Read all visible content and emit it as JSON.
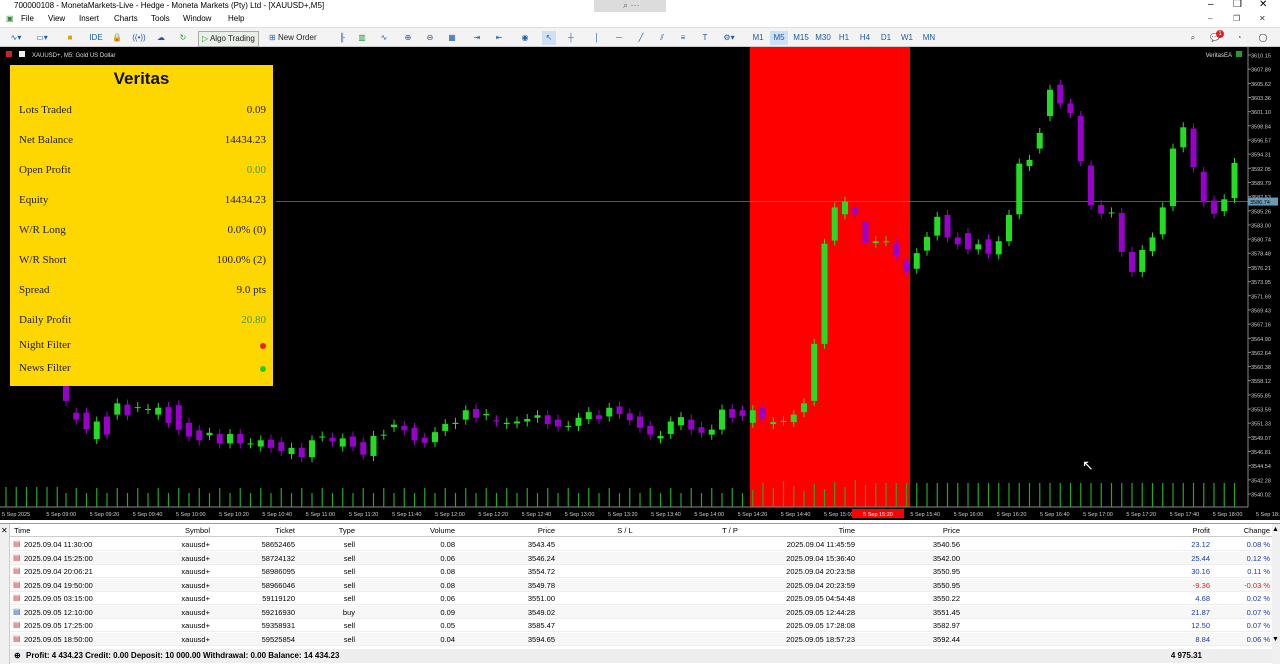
{
  "window": {
    "title": "700000108 - MonetaMarkets-Live - Hedge - Moneta Markets (Pty) Ltd - [XAUUSD+,M5]"
  },
  "menu": [
    "File",
    "View",
    "Insert",
    "Charts",
    "Tools",
    "Window",
    "Help"
  ],
  "toolbar": {
    "ide_label": "IDE",
    "algo_trading_label": "Algo Trading",
    "new_order_label": "New Order",
    "timeframes": [
      "M1",
      "M5",
      "M15",
      "M30",
      "H1",
      "H4",
      "D1",
      "W1",
      "MN"
    ],
    "active_timeframe": "M5",
    "notification_count": "1"
  },
  "chart": {
    "symbol_label": "XAUUSD+, M5:  Gold US Dollar",
    "ea_label": "VeritasEA",
    "current_price": "3586.74",
    "price_ticks": [
      "3610.15",
      "3607.89",
      "3605.62",
      "3603.36",
      "3601.10",
      "3598.84",
      "3596.57",
      "3594.31",
      "3592.05",
      "3589.79",
      "3587.53",
      "3585.26",
      "3583.00",
      "3580.74",
      "3578.48",
      "3576.21",
      "3573.95",
      "3571.69",
      "3569.43",
      "3567.16",
      "3564.90",
      "3562.64",
      "3560.38",
      "3558.12",
      "3555.85",
      "3553.59",
      "3551.33",
      "3549.07",
      "3546.81",
      "3544.54",
      "3542.28",
      "3540.02"
    ],
    "time_ticks": [
      "5 Sep 2025",
      "5 Sep 09:00",
      "5 Sep 09:20",
      "5 Sep 09:40",
      "5 Sep 10:00",
      "5 Sep 10:20",
      "5 Sep 10:40",
      "5 Sep 11:00",
      "5 Sep 11:20",
      "5 Sep 11:40",
      "5 Sep 12:00",
      "5 Sep 12:20",
      "5 Sep 12:40",
      "5 Sep 13:00",
      "5 Sep 13:20",
      "5 Sep 13:40",
      "5 Sep 14:00",
      "5 Sep 14:20",
      "5 Sep 14:40",
      "5 Sep 15:00",
      "5 Sep 15:20",
      "5 Sep 15:40",
      "5 Sep 16:00",
      "5 Sep 16:20",
      "5 Sep 16:40",
      "5 Sep 17:00",
      "5 Sep 17:20",
      "5 Sep 17:40",
      "5 Sep 18:00",
      "5 Sep 18:20"
    ],
    "highlight_time": "5 Sep 15:20",
    "colors": {
      "bull": "#22dd22",
      "bear": "#9900cc",
      "zone": "#ff0000",
      "bg": "#000000"
    }
  },
  "panel": {
    "title": "Veritas",
    "rows": [
      {
        "label": "Lots Traded",
        "value": "0.09",
        "color": "#333333"
      },
      {
        "label": "Net Balance",
        "value": "14434.23",
        "color": "#333333"
      },
      {
        "label": "Open Profit",
        "value": "0.00",
        "color": "#3a9a3a"
      },
      {
        "label": "Equity",
        "value": "14434.23",
        "color": "#333333"
      },
      {
        "label": "W/R Long",
        "value": "0.0% (0)",
        "color": "#333333"
      },
      {
        "label": "W/R Short",
        "value": "100.0% (2)",
        "color": "#333333"
      },
      {
        "label": "Spread",
        "value": "9.0 pts",
        "color": "#333333"
      },
      {
        "label": "Daily Profit",
        "value": "20.80",
        "color": "#3a9a3a"
      }
    ],
    "filters": [
      {
        "label": "Night Filter",
        "status_color": "#ee2222"
      },
      {
        "label": "News Filter",
        "status_color": "#22cc22"
      }
    ]
  },
  "history": {
    "columns": [
      "Time",
      "Symbol",
      "Ticket",
      "Type",
      "Volume",
      "Price",
      "S / L",
      "T / P",
      "Time",
      "Price",
      "Profit",
      "Change"
    ],
    "rows": [
      [
        "2025.09.04 11:30:00",
        "xauusd+",
        "58652465",
        "sell",
        "0.08",
        "3543.45",
        "",
        "",
        "2025.09.04 11:45:59",
        "3540.56",
        "23.12",
        "0.08 %"
      ],
      [
        "2025.09.04 15:25:00",
        "xauusd+",
        "58724132",
        "sell",
        "0.06",
        "3546.24",
        "",
        "",
        "2025.09.04 15:36:40",
        "3542.00",
        "25.44",
        "0.12 %"
      ],
      [
        "2025.09.04 20:06:21",
        "xauusd+",
        "58986095",
        "sell",
        "0.08",
        "3554.72",
        "",
        "",
        "2025.09.04 20:23:58",
        "3550.95",
        "30.16",
        "0.11 %"
      ],
      [
        "2025.09.04 19:50:00",
        "xauusd+",
        "58966046",
        "sell",
        "0.08",
        "3549.78",
        "",
        "",
        "2025.09.04 20:23:59",
        "3550.95",
        "-9.36",
        "-0.03 %"
      ],
      [
        "2025.09.05 03:15:00",
        "xauusd+",
        "59119120",
        "sell",
        "0.06",
        "3551.00",
        "",
        "",
        "2025.09.05 04:54:48",
        "3550.22",
        "4.68",
        "0.02 %"
      ],
      [
        "2025.09.05 12:10:00",
        "xauusd+",
        "59216930",
        "buy",
        "0.09",
        "3549.02",
        "",
        "",
        "2025.09.05 12:44:28",
        "3551.45",
        "21.87",
        "0.07 %"
      ],
      [
        "2025.09.05 17:25:00",
        "xauusd+",
        "59358931",
        "sell",
        "0.05",
        "3585.47",
        "",
        "",
        "2025.09.05 17:28:08",
        "3582.97",
        "12.50",
        "0.07 %"
      ],
      [
        "2025.09.05 18:50:00",
        "xauusd+",
        "59525854",
        "sell",
        "0.04",
        "3594.65",
        "",
        "",
        "2025.09.05 18:57:23",
        "3592.44",
        "8.84",
        "0.06 %"
      ]
    ],
    "summary": "Profit: 4 434.23  Credit: 0.00  Deposit: 10 000.00  Withdrawal: 0.00  Balance: 14 434.23",
    "summary_total": "4 975.31"
  },
  "chart_data": {
    "type": "candlestick",
    "bars": [
      {
        "o": 3558.9,
        "c": 3554.9
      },
      {
        "o": 3553.0,
        "c": 3551.9
      },
      {
        "o": 3553.0,
        "c": 3550.4
      },
      {
        "o": 3548.8,
        "c": 3551.6
      },
      {
        "o": 3552.4,
        "c": 3549.5
      },
      {
        "o": 3552.7,
        "c": 3554.5
      },
      {
        "o": 3554.3,
        "c": 3552.6
      },
      {
        "o": 3553.9,
        "c": 3553.9
      },
      {
        "o": 3553.6,
        "c": 3553.6
      },
      {
        "o": 3552.7,
        "c": 3553.8
      },
      {
        "o": 3553.9,
        "c": 3551.4
      },
      {
        "o": 3554.2,
        "c": 3550.3
      },
      {
        "o": 3551.4,
        "c": 3549.2
      },
      {
        "o": 3550.2,
        "c": 3548.6
      },
      {
        "o": 3549.4,
        "c": 3549.8
      },
      {
        "o": 3549.6,
        "c": 3548.1
      },
      {
        "o": 3548.1,
        "c": 3549.6
      },
      {
        "o": 3549.6,
        "c": 3548.1
      },
      {
        "o": 3548.1,
        "c": 3548.1
      },
      {
        "o": 3547.6,
        "c": 3548.6
      },
      {
        "o": 3548.7,
        "c": 3547.4
      },
      {
        "o": 3548.3,
        "c": 3546.9
      },
      {
        "o": 3546.4,
        "c": 3547.4
      },
      {
        "o": 3547.4,
        "c": 3545.9
      },
      {
        "o": 3545.9,
        "c": 3548.6
      },
      {
        "o": 3549.2,
        "c": 3549.2
      },
      {
        "o": 3549.0,
        "c": 3548.4
      },
      {
        "o": 3547.6,
        "c": 3548.9
      },
      {
        "o": 3549.2,
        "c": 3547.6
      },
      {
        "o": 3548.3,
        "c": 3546.3
      },
      {
        "o": 3546.1,
        "c": 3549.3
      },
      {
        "o": 3549.5,
        "c": 3549.5
      },
      {
        "o": 3550.7,
        "c": 3551.1
      },
      {
        "o": 3550.9,
        "c": 3550.2
      },
      {
        "o": 3550.6,
        "c": 3548.6
      },
      {
        "o": 3549.0,
        "c": 3548.2
      },
      {
        "o": 3548.3,
        "c": 3549.9
      },
      {
        "o": 3550.1,
        "c": 3551.2
      },
      {
        "o": 3551.2,
        "c": 3551.4
      },
      {
        "o": 3551.9,
        "c": 3553.4
      },
      {
        "o": 3553.6,
        "c": 3552.2
      },
      {
        "o": 3552.6,
        "c": 3552.8
      },
      {
        "o": 3551.8,
        "c": 3551.6
      },
      {
        "o": 3551.2,
        "c": 3551.4
      },
      {
        "o": 3551.3,
        "c": 3551.6
      },
      {
        "o": 3551.6,
        "c": 3552.0
      },
      {
        "o": 3552.2,
        "c": 3552.6
      },
      {
        "o": 3552.6,
        "c": 3551.2
      },
      {
        "o": 3551.9,
        "c": 3550.8
      },
      {
        "o": 3550.9,
        "c": 3550.9
      },
      {
        "o": 3550.9,
        "c": 3552.2
      },
      {
        "o": 3552.0,
        "c": 3553.1
      },
      {
        "o": 3552.6,
        "c": 3552.0
      },
      {
        "o": 3552.4,
        "c": 3553.8
      },
      {
        "o": 3554.0,
        "c": 3552.8
      },
      {
        "o": 3552.9,
        "c": 3551.8
      },
      {
        "o": 3552.4,
        "c": 3550.6
      },
      {
        "o": 3550.9,
        "c": 3549.5
      },
      {
        "o": 3548.9,
        "c": 3549.3
      },
      {
        "o": 3549.6,
        "c": 3551.6
      },
      {
        "o": 3551.0,
        "c": 3552.3
      },
      {
        "o": 3551.9,
        "c": 3550.3
      },
      {
        "o": 3550.7,
        "c": 3549.8
      },
      {
        "o": 3549.5,
        "c": 3550.3
      },
      {
        "o": 3550.3,
        "c": 3553.5
      },
      {
        "o": 3553.6,
        "c": 3552.2
      },
      {
        "o": 3553.4,
        "c": 3552.5
      },
      {
        "o": 3551.4,
        "c": 3553.4
      },
      {
        "o": 3553.8,
        "c": 3552.1
      },
      {
        "o": 3551.2,
        "c": 3551.5
      },
      {
        "o": 3551.7,
        "c": 3551.7
      },
      {
        "o": 3551.5,
        "c": 3552.7
      },
      {
        "o": 3553.1,
        "c": 3554.5
      },
      {
        "o": 3554.9,
        "c": 3564.0
      },
      {
        "o": 3564.0,
        "c": 3580.0
      },
      {
        "o": 3580.5,
        "c": 3585.8
      },
      {
        "o": 3584.7,
        "c": 3586.7
      },
      {
        "o": 3585.8,
        "c": 3584.7
      },
      {
        "o": 3583.5,
        "c": 3580.1
      },
      {
        "o": 3580.1,
        "c": 3580.4
      },
      {
        "o": 3580.4,
        "c": 3580.4
      },
      {
        "o": 3580.1,
        "c": 3578.0
      },
      {
        "o": 3577.1,
        "c": 3575.7
      },
      {
        "o": 3576.0,
        "c": 3578.5
      },
      {
        "o": 3578.9,
        "c": 3581.1
      },
      {
        "o": 3581.3,
        "c": 3584.3
      },
      {
        "o": 3584.6,
        "c": 3581.0
      },
      {
        "o": 3581.0,
        "c": 3579.9
      },
      {
        "o": 3581.7,
        "c": 3579.1
      },
      {
        "o": 3579.1,
        "c": 3579.9
      },
      {
        "o": 3580.7,
        "c": 3578.4
      },
      {
        "o": 3578.3,
        "c": 3580.4
      },
      {
        "o": 3580.4,
        "c": 3584.6
      },
      {
        "o": 3584.7,
        "c": 3592.8
      },
      {
        "o": 3592.4,
        "c": 3593.4
      },
      {
        "o": 3595.2,
        "c": 3597.7
      },
      {
        "o": 3600.4,
        "c": 3604.6
      },
      {
        "o": 3605.4,
        "c": 3602.4
      },
      {
        "o": 3602.4,
        "c": 3600.9
      },
      {
        "o": 3600.4,
        "c": 3593.2
      },
      {
        "o": 3592.5,
        "c": 3586.2
      },
      {
        "o": 3586.2,
        "c": 3584.8
      },
      {
        "o": 3585.0,
        "c": 3585.0
      },
      {
        "o": 3584.9,
        "c": 3578.7
      },
      {
        "o": 3578.7,
        "c": 3575.5
      },
      {
        "o": 3575.5,
        "c": 3579.0
      },
      {
        "o": 3578.8,
        "c": 3581.0
      },
      {
        "o": 3581.5,
        "c": 3585.8
      },
      {
        "o": 3586.0,
        "c": 3595.2
      },
      {
        "o": 3595.4,
        "c": 3598.6
      },
      {
        "o": 3598.4,
        "c": 3592.2
      },
      {
        "o": 3591.5,
        "c": 3586.6
      },
      {
        "o": 3586.9,
        "c": 3584.8
      },
      {
        "o": 3585.2,
        "c": 3587.1
      },
      {
        "o": 3587.3,
        "c": 3592.9
      }
    ]
  }
}
